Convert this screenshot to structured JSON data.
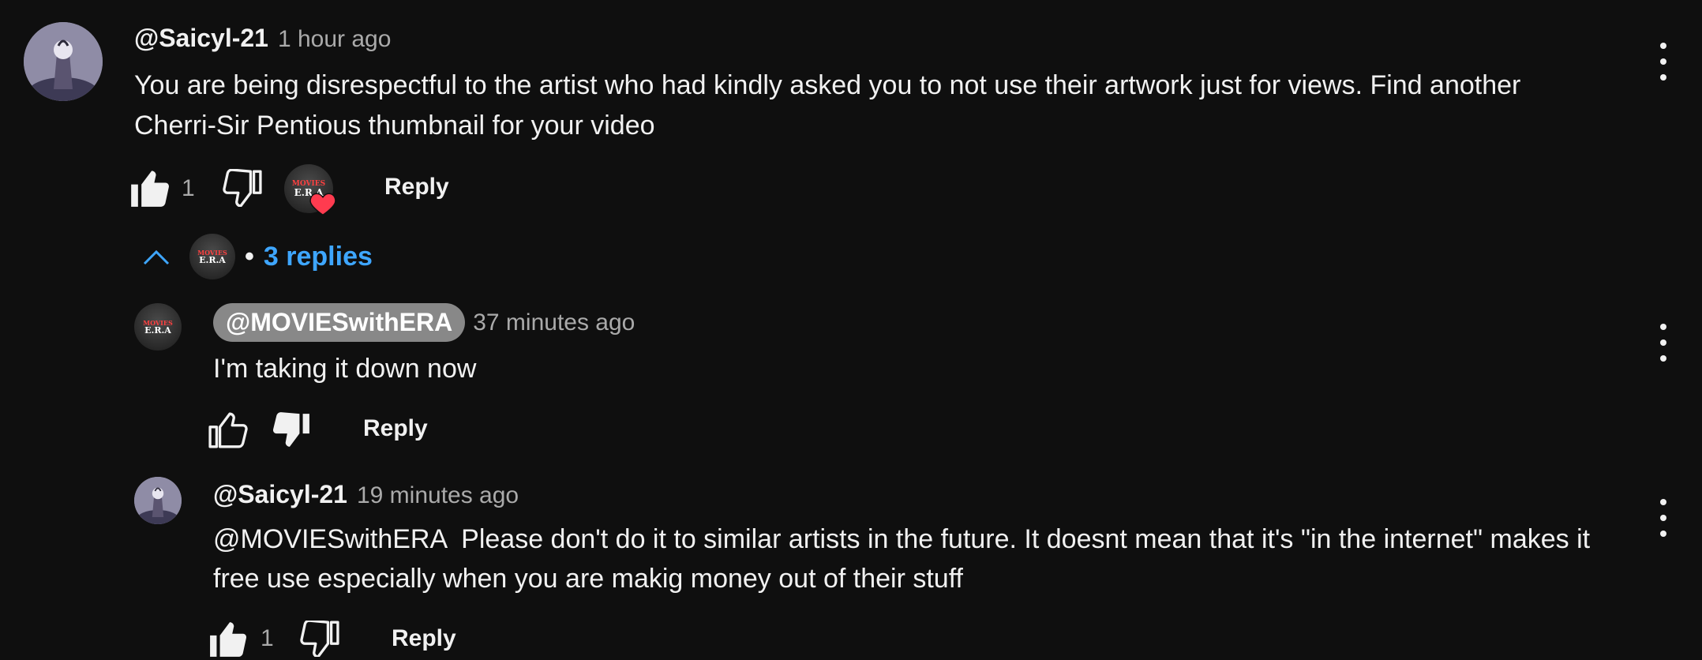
{
  "comment": {
    "author": "@Saicyl-21",
    "time": "1 hour ago",
    "text_line1": "You are being disrespectful to the artist who had kindly asked you to not use their artwork just for views. Find another",
    "text_line2": "Cherri-Sir Pentious thumbnail for your video",
    "like_count": "1",
    "reply_label": "Reply",
    "hearted_avatar": {
      "top": "MOVIES",
      "bottom": "E.R.A"
    },
    "replies_toggle_label": "3 replies",
    "bullet": "•"
  },
  "replies": [
    {
      "author": "@MOVIESwithERA",
      "time": "37 minutes ago",
      "text": "I'm taking it down now",
      "reply_label": "Reply",
      "avatar": {
        "top": "MOVIES",
        "bottom": "E.R.A"
      }
    },
    {
      "author": "@Saicyl-21",
      "time": "19 minutes ago",
      "text_line1": "@MOVIESwithERA  Please don't do it to similar artists in the future. It doesnt mean that it's \"in the internet\" makes it",
      "text_line2": "free use especially when you are makig money out of their stuff",
      "like_count": "1",
      "reply_label": "Reply"
    }
  ],
  "colors": {
    "background": "#0f0f0f",
    "text": "#f1f1f1",
    "secondary": "#aaaaaa",
    "link": "#3ea6ff",
    "heart": "#ff3b4f",
    "author_chip": "#888888"
  },
  "icons": [
    "like-icon",
    "dislike-icon",
    "heart-icon",
    "chevron-up-icon",
    "more-vert-icon"
  ]
}
